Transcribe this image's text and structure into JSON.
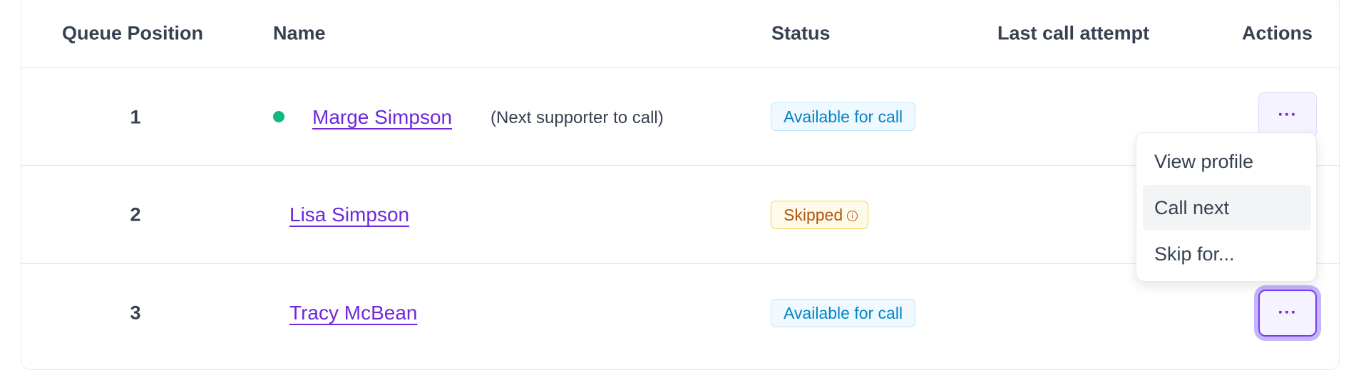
{
  "table": {
    "headers": {
      "queue_position": "Queue Position",
      "name": "Name",
      "status": "Status",
      "last_call_attempt": "Last call attempt",
      "actions": "Actions"
    },
    "rows": [
      {
        "position": "1",
        "name": "Marge Simpson",
        "note": "(Next supporter to call)",
        "status": "Available for call",
        "status_type": "available",
        "last_call_attempt": "",
        "online": true
      },
      {
        "position": "2",
        "name": "Lisa Simpson",
        "note": "",
        "status": "Skipped",
        "status_type": "skipped",
        "last_call_attempt": "",
        "online": false
      },
      {
        "position": "3",
        "name": "Tracy McBean",
        "note": "",
        "status": "Available for call",
        "status_type": "available",
        "last_call_attempt": "",
        "online": false
      }
    ]
  },
  "actions_button_label": "···",
  "actions_menu": {
    "items": [
      "View profile",
      "Call next",
      "Skip for..."
    ],
    "highlighted_item": "Call next"
  },
  "colors": {
    "link": "#6d28d9",
    "online_dot": "#10b981",
    "available_text": "#0284c7",
    "available_bg": "#f0f9ff",
    "available_border": "#bae6fd",
    "skipped_text": "#b45309",
    "skipped_bg": "#fffbeb",
    "skipped_border": "#fcd34d",
    "action_button_bg": "#f5f3ff",
    "focus_ring": "#c4b5fd"
  }
}
